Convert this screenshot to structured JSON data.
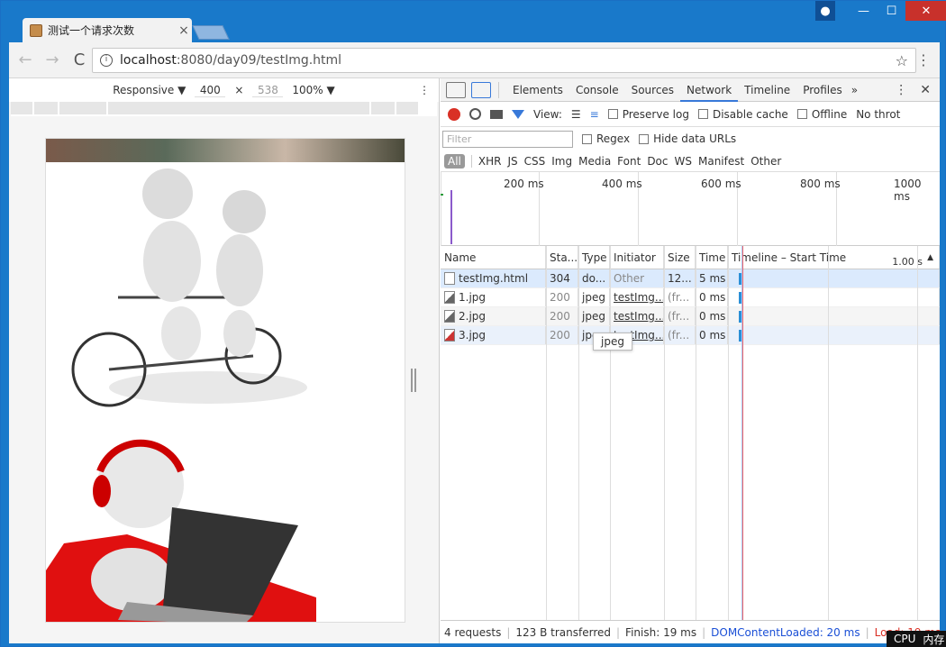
{
  "window": {
    "tab_title": "测试一个请求次数",
    "tab_close": "×",
    "btn_min": "—",
    "btn_max": "☐",
    "btn_close": "✕"
  },
  "toolbar": {
    "back": "←",
    "forward": "→",
    "reload": "C",
    "url_host": "localhost",
    "url_path": ":8080/day09/testImg.html",
    "star": "☆",
    "menu": "⋮"
  },
  "device_bar": {
    "mode": "Responsive ▼",
    "width": "400",
    "x": "×",
    "height": "538",
    "zoom": "100% ▼",
    "menu": "⋮"
  },
  "devtools": {
    "tabs": [
      "Elements",
      "Console",
      "Sources",
      "Network",
      "Timeline",
      "Profiles"
    ],
    "active_tab": "Network",
    "more": "»",
    "menu": "⋮",
    "close": "✕",
    "view_label": "View:",
    "preserve_log": "Preserve log",
    "disable_cache": "Disable cache",
    "offline": "Offline",
    "throttle": "No throt",
    "filter_placeholder": "Filter",
    "regex": "Regex",
    "hide_data_urls": "Hide data URLs",
    "types": [
      "All",
      "XHR",
      "JS",
      "CSS",
      "Img",
      "Media",
      "Font",
      "Doc",
      "WS",
      "Manifest",
      "Other"
    ],
    "overview_ticks": [
      "200 ms",
      "400 ms",
      "600 ms",
      "800 ms",
      "1000 ms"
    ],
    "columns": [
      "Name",
      "Sta...",
      "Type",
      "Initiator",
      "Size",
      "Time",
      "Timeline – Start Time",
      "1.00 s"
    ],
    "rows": [
      {
        "name": "testImg.html",
        "status": "304",
        "type": "do...",
        "initiator": "Other",
        "size": "12...",
        "time": "5 ms"
      },
      {
        "name": "1.jpg",
        "status": "200",
        "type": "jpeg",
        "initiator": "testImg...",
        "size": "(fr...",
        "time": "0 ms"
      },
      {
        "name": "2.jpg",
        "status": "200",
        "type": "jpeg",
        "initiator": "testImg...",
        "size": "(fr...",
        "time": "0 ms"
      },
      {
        "name": "3.jpg",
        "status": "200",
        "type": "jpeg",
        "initiator": "testImg...",
        "size": "(fr...",
        "time": "0 ms"
      }
    ],
    "tooltip": "jpeg",
    "status": {
      "requests": "4 requests",
      "transferred": "123 B transferred",
      "finish": "Finish: 19 ms",
      "dcl": "DOMContentLoaded: 20 ms",
      "load": "Load: 19 ms",
      "sep": "|"
    }
  },
  "taskbar": {
    "cpu": "CPU",
    "mem": "内存"
  },
  "colors": {
    "accent": "#3879d9",
    "record": "#d93025",
    "frame": "#1979ca"
  }
}
